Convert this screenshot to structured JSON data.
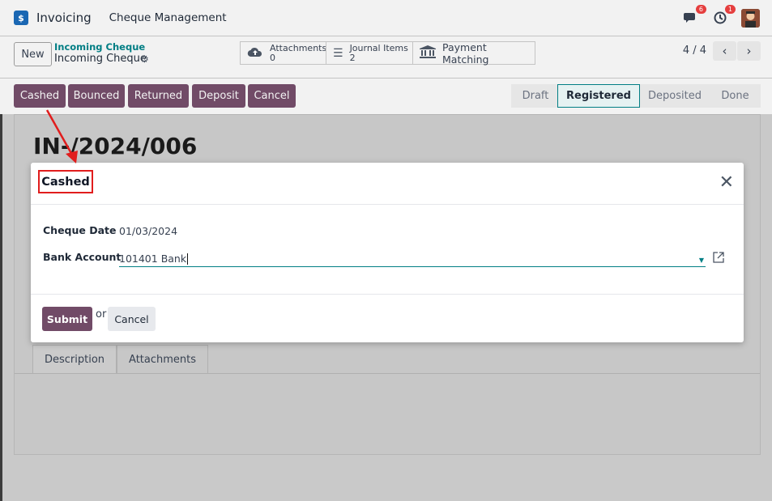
{
  "nav": {
    "app_name": "Invoicing",
    "menu_item": "Cheque Management",
    "chat_badge": "6",
    "activity_badge": "1"
  },
  "control": {
    "new_label": "New",
    "breadcrumb_parent": "Incoming Cheque",
    "breadcrumb_current": "Incoming Cheque",
    "attachments_label": "Attachments",
    "attachments_count": "0",
    "journal_label": "Journal Items",
    "journal_count": "2",
    "payment_matching_label": "Payment Matching",
    "pager": "4 / 4"
  },
  "actions": {
    "cashed": "Cashed",
    "bounced": "Bounced",
    "returned": "Returned",
    "deposit": "Deposit",
    "cancel": "Cancel"
  },
  "statusbar": [
    "Draft",
    "Registered",
    "Deposited",
    "Done"
  ],
  "sheet": {
    "title": "IN-/2024/006",
    "tabs": [
      "Description",
      "Attachments"
    ]
  },
  "modal": {
    "title": "Cashed",
    "cheque_date_label": "Cheque Date",
    "cheque_date_value": "01/03/2024",
    "bank_account_label": "Bank Account",
    "bank_account_value": "101401 Bank",
    "submit_label": "Submit",
    "or_text": "or",
    "cancel_label": "Cancel"
  },
  "colors": {
    "primary": "#714b67",
    "accent": "#017e84",
    "highlight_box": "#e11d1d"
  }
}
